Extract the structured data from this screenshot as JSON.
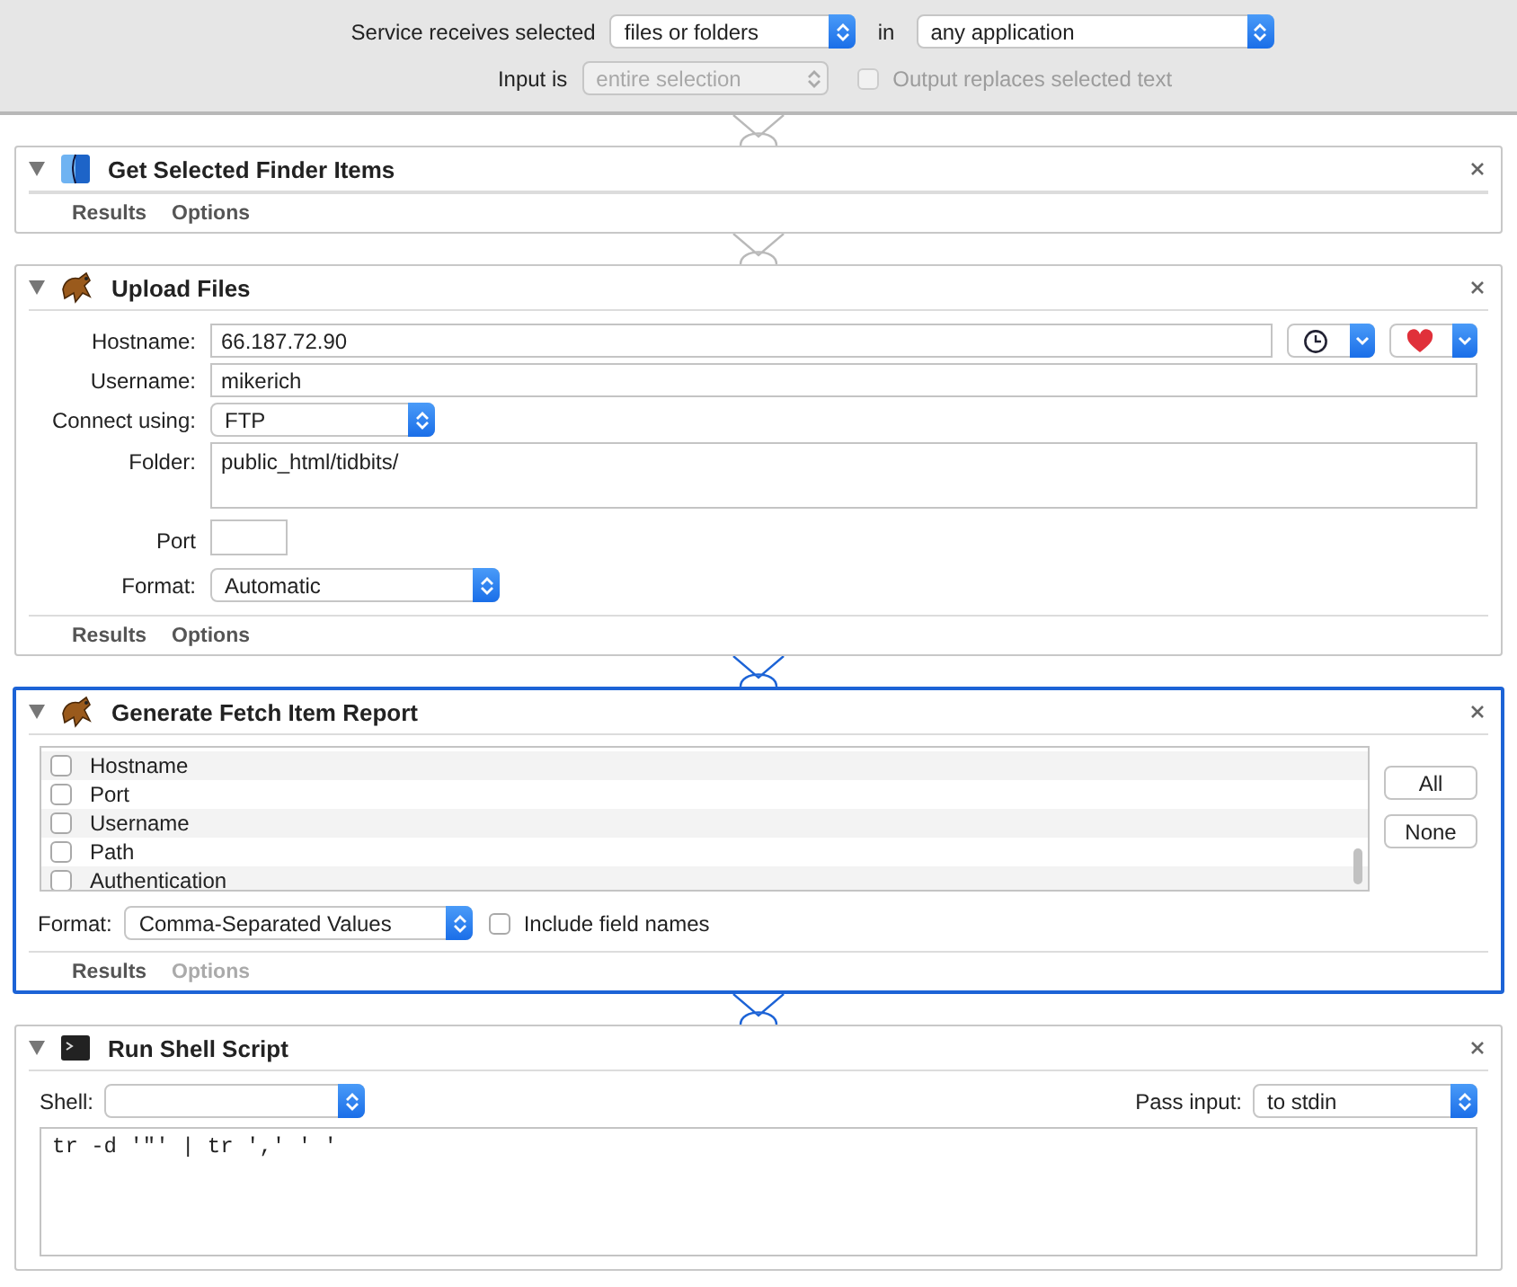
{
  "header": {
    "receives_label": "Service receives selected",
    "receives_value": "files or folders",
    "in_label": "in",
    "application": "any application",
    "input_label": "Input is",
    "input_value": "entire selection",
    "input_disabled": true,
    "output_replaces": {
      "label": "Output replaces selected text",
      "checked": false,
      "disabled": true
    }
  },
  "actions": [
    {
      "kind": "finder",
      "title": "Get Selected Finder Items",
      "selected": false,
      "expanded": true,
      "tabs": [
        {
          "label": "Results",
          "disabled": false
        },
        {
          "label": "Options",
          "disabled": false
        }
      ]
    },
    {
      "kind": "upload",
      "title": "Upload Files",
      "selected": false,
      "expanded": true,
      "hostname_label": "Hostname:",
      "hostname": "66.187.72.90",
      "username_label": "Username:",
      "username": "mikerich",
      "connect_label": "Connect using:",
      "connect": "FTP",
      "folder_label": "Folder:",
      "folder": "public_html/tidbits/",
      "port_label": "Port",
      "format_label": "Format:",
      "format": "Automatic",
      "tabs": [
        {
          "label": "Results",
          "disabled": false
        },
        {
          "label": "Options",
          "disabled": false
        }
      ]
    },
    {
      "kind": "report",
      "title": "Generate Fetch Item Report",
      "selected": true,
      "expanded": true,
      "items": [
        {
          "label": "Hostname",
          "checked": false
        },
        {
          "label": "Port",
          "checked": false
        },
        {
          "label": "Username",
          "checked": false
        },
        {
          "label": "Path",
          "checked": false
        },
        {
          "label": "Authentication",
          "checked": false
        }
      ],
      "buttons": [
        "All",
        "None"
      ],
      "format_label": "Format:",
      "format": "Comma-Separated Values",
      "include": {
        "label": "Include field names",
        "checked": false
      },
      "tabs": [
        {
          "label": "Results",
          "disabled": false
        },
        {
          "label": "Options",
          "disabled": true
        }
      ]
    },
    {
      "kind": "shell",
      "title": "Run Shell Script",
      "selected": false,
      "expanded": true,
      "shell_label": "Shell:",
      "pass_label": "Pass input:",
      "pass": "to stdin",
      "script": "tr -d '\"' | tr ',' ' '"
    }
  ]
}
